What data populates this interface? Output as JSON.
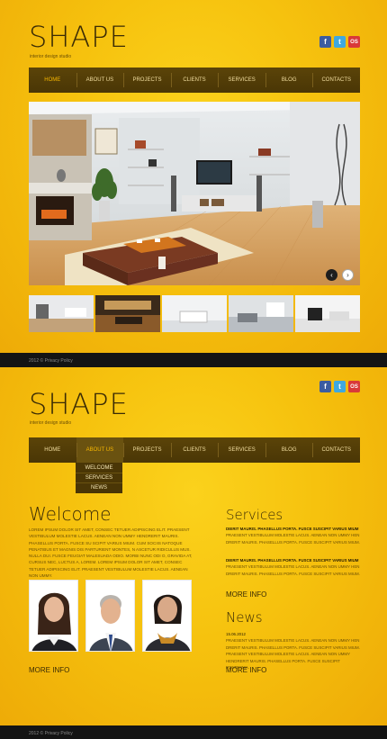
{
  "brand": {
    "logo": "SHAPE",
    "tagline": "interior design studio"
  },
  "social": {
    "facebook": "f",
    "twitter": "t",
    "odnoklassniki": "OS"
  },
  "nav": {
    "items": [
      {
        "label": "HOME"
      },
      {
        "label": "ABOUT US"
      },
      {
        "label": "PROJECTS"
      },
      {
        "label": "CLIENTS"
      },
      {
        "label": "SERVICES"
      },
      {
        "label": "BLOG"
      },
      {
        "label": "CONTACTS"
      }
    ],
    "active_page1": "HOME",
    "active_page2": "ABOUT US"
  },
  "slider": {
    "prev": "‹",
    "next": "›"
  },
  "dropdown": {
    "items": [
      {
        "label": "WELCOME"
      },
      {
        "label": "SERVICES"
      },
      {
        "label": "NEWS"
      }
    ]
  },
  "welcome": {
    "heading": "Welcome",
    "text": "Lorem ipsum dolor sit amet, consec tetuer adipiscing elit. Praesent vestibulum molestie lacus. Aenean non ummy hendrerit mauris. Phasellus porta. Fusce su scipit varius mium. Cum sociis natoque penatibus et magnis dis parturient montes, n ascetur ridiculus mus. Nulla dui. Fusce feugiat malesuada odio. Morbi nunc odi o, gravida at, cursus nec, luctus a, lorem. Lorem ipsum dolor sit amet, consec tetuer adipiscing elit. Praesent vestibulum molestie lacus. Aenean non ummy.",
    "more": "MORE INFO"
  },
  "services": {
    "heading": "Services",
    "blocks": [
      {
        "title": "Dierit mauris. Phasellus porta. Fusce suscipit varius mium",
        "text": "Praesent vestibulum molestie lacus. Aenean non ummy hen drerit mauris. Phasellus porta. Fusce suscipit varius mium."
      },
      {
        "title": "Dierit mauris. Phasellus porta. Fusce suscipit varius mium",
        "text": "Praesent vestibulum molestie lacus. Aenean non ummy hen drerit mauris. Phasellus porta. Fusce suscipit varius mium."
      }
    ],
    "more": "MORE INFO"
  },
  "news": {
    "heading": "News",
    "date": "15.06.2012",
    "text": "Praesent vestibulum molestie lacus. Aenean non ummy hen drerit mauris. Phasellus porta. Fusce suscipit varius mium. Praesent vestibulum molestie lacus. Aenean non ummy hendrerit mauris. Phasellus porta. Fusce suscipit pontesma.",
    "more": "MORE INFO"
  },
  "footer": {
    "text": "2012 © Privacy Policy"
  },
  "colors": {
    "background": "#f6c20e",
    "nav": "#4a3606",
    "active": "#f7b700",
    "footer": "#141414"
  }
}
